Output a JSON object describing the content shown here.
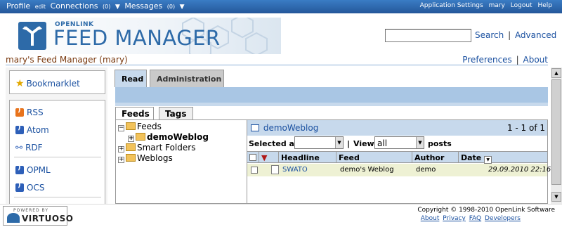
{
  "topbar": {
    "profile": "Profile",
    "profile_edit": "edit",
    "connections": "Connections",
    "connections_count": "(0)",
    "messages": "Messages",
    "messages_count": "(0)",
    "arrow": "▼",
    "app_settings": "Application Settings",
    "user": "mary",
    "logout": "Logout",
    "help": "Help"
  },
  "logo": {
    "company": "OPENLINK",
    "product": "FEED MANAGER"
  },
  "search": {
    "value": "",
    "search_link": "Search",
    "sep": "|",
    "advanced_link": "Advanced"
  },
  "page": {
    "title": "mary's Feed Manager (mary)",
    "preferences": "Preferences",
    "sep": "|",
    "about": "About"
  },
  "sidebar": {
    "bookmarklet": "Bookmarklet",
    "feeds": [
      "RSS",
      "Atom",
      "RDF"
    ],
    "exports": [
      "OPML",
      "OCS"
    ]
  },
  "tabs": {
    "read": "Read",
    "administration": "Administration"
  },
  "subtabs": {
    "feeds": "Feeds",
    "tags": "Tags"
  },
  "tree": {
    "root": "Feeds",
    "root_child": "demoWeblog",
    "smart_folders": "Smart Folders",
    "weblogs": "Weblogs",
    "minus": "−",
    "plus": "+"
  },
  "panel": {
    "title": "demoWeblog",
    "count": "1 - 1 of 1",
    "selected_as": "Selected as",
    "view_sep": "|",
    "view": "View",
    "view_value": "all",
    "posts": "posts",
    "columns": {
      "headline": "Headline",
      "feed": "Feed",
      "author": "Author",
      "date": "Date"
    },
    "rows": [
      {
        "headline": "SWATO",
        "feed": "demo's Weblog",
        "author": "demo",
        "date": "29.09.2010 22:16"
      }
    ]
  },
  "footer": {
    "powered_by": "POWERED BY",
    "virtuoso": "VIRTUOSO",
    "copyright": "Copyright © 1998-2010 OpenLink Software",
    "about": "About",
    "privacy": "Privacy",
    "faq": "FAQ",
    "developers": "Developers"
  },
  "colors": {
    "topbar": "#2d6ab0",
    "accent": "#c7d9ec",
    "link": "#1a50a0",
    "title": "#7a3a10",
    "row_highlight": "#eef1d4"
  }
}
